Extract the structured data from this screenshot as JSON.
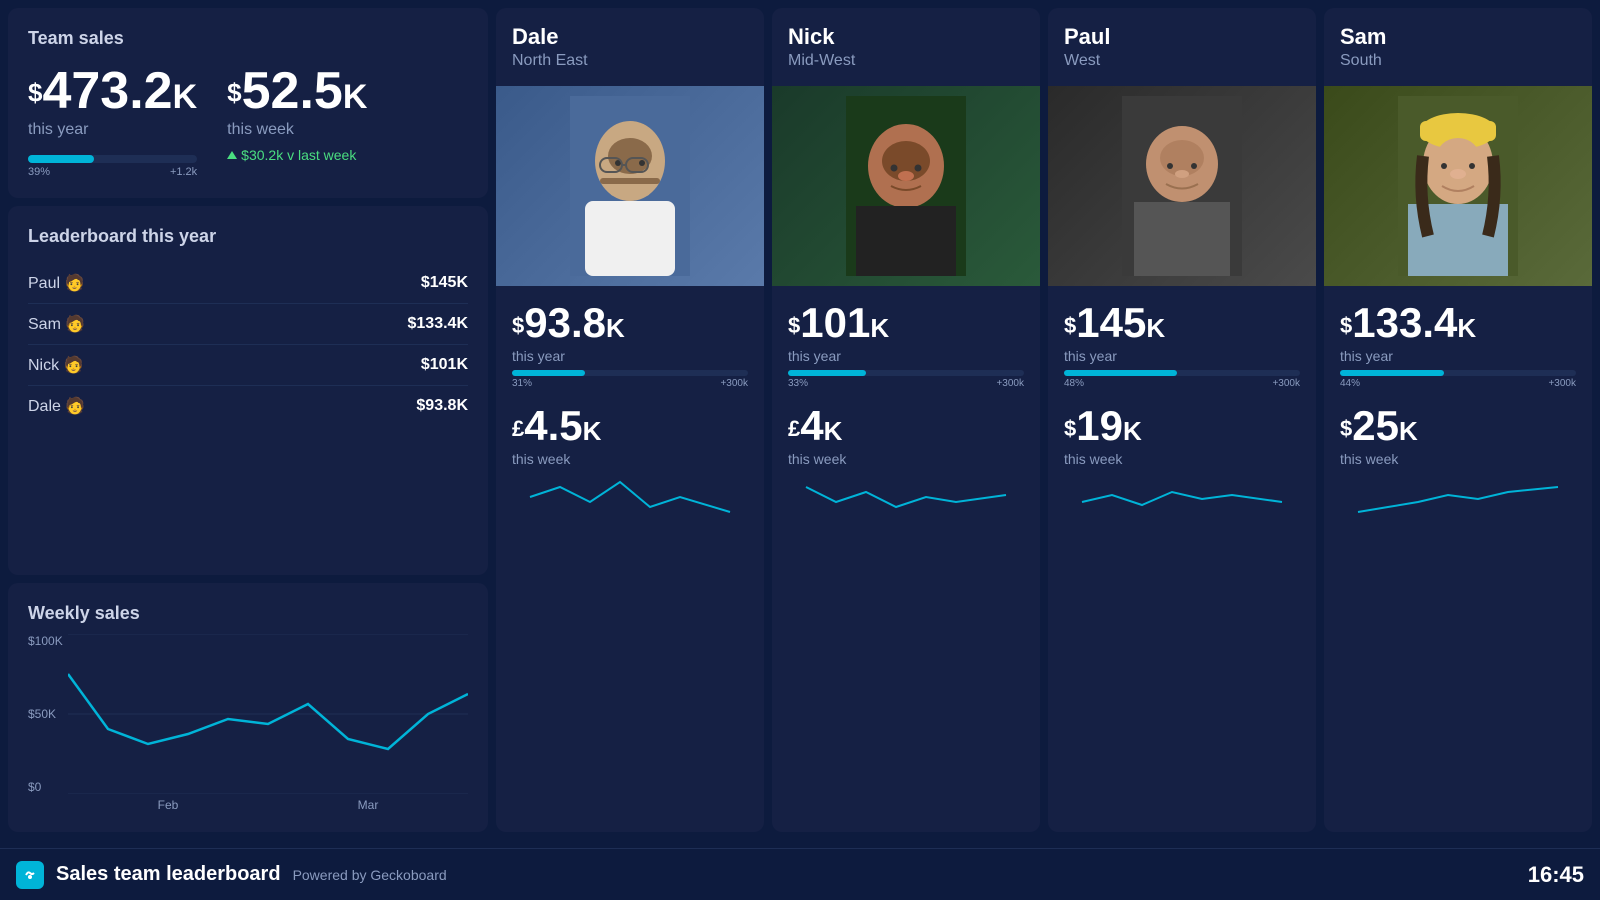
{
  "teamSales": {
    "title": "Team sales",
    "thisYear": {
      "amount": "473.2",
      "unit": "K",
      "currency": "$",
      "label": "this year",
      "progress": 39,
      "progressMax": "+1.2k"
    },
    "thisWeek": {
      "amount": "52.5",
      "unit": "K",
      "currency": "$",
      "label": "this week",
      "trend": "$30.2k v last week",
      "trendValue": "30.2k"
    }
  },
  "leaderboard": {
    "title": "Leaderboard this year",
    "items": [
      {
        "name": "Paul 🧑",
        "value": "$145K"
      },
      {
        "name": "Sam 🧑",
        "value": "$133.4K"
      },
      {
        "name": "Nick 🧑",
        "value": "$101K"
      },
      {
        "name": "Dale 🧑",
        "value": "$93.8K"
      }
    ]
  },
  "weeklySales": {
    "title": "Weekly sales",
    "yLabels": [
      "$100K",
      "$50K",
      "$0"
    ],
    "xLabels": [
      "Feb",
      "Mar"
    ]
  },
  "persons": [
    {
      "name": "Dale",
      "region": "North East",
      "photoEmoji": "👨",
      "photoColor": "#2d4a7a",
      "thisYear": {
        "amount": "93.8",
        "currency": "$",
        "unit": "K",
        "label": "this year",
        "progress": 31,
        "progressMax": "+300k"
      },
      "thisWeek": {
        "amount": "4.5",
        "currency": "£",
        "unit": "K",
        "label": "this week"
      }
    },
    {
      "name": "Nick",
      "region": "Mid-West",
      "photoEmoji": "👨",
      "photoColor": "#1a3a2a",
      "thisYear": {
        "amount": "101",
        "currency": "$",
        "unit": "K",
        "label": "this year",
        "progress": 33,
        "progressMax": "+300k"
      },
      "thisWeek": {
        "amount": "4",
        "currency": "£",
        "unit": "K",
        "label": "this week"
      }
    },
    {
      "name": "Paul",
      "region": "West",
      "photoEmoji": "👨",
      "photoColor": "#2a2a2a",
      "thisYear": {
        "amount": "145",
        "currency": "$",
        "unit": "K",
        "label": "this year",
        "progress": 48,
        "progressMax": "+300k"
      },
      "thisWeek": {
        "amount": "19",
        "currency": "$",
        "unit": "K",
        "label": "this week"
      }
    },
    {
      "name": "Sam",
      "region": "South",
      "photoEmoji": "👩",
      "photoColor": "#3a4a2a",
      "thisYear": {
        "amount": "133.4",
        "currency": "$",
        "unit": "K",
        "label": "this year",
        "progress": 44,
        "progressMax": "+300k"
      },
      "thisWeek": {
        "amount": "25",
        "currency": "$",
        "unit": "K",
        "label": "this week"
      }
    }
  ],
  "footer": {
    "title": "Sales team leaderboard",
    "powered": "Powered by Geckoboard",
    "time": "16:45"
  }
}
